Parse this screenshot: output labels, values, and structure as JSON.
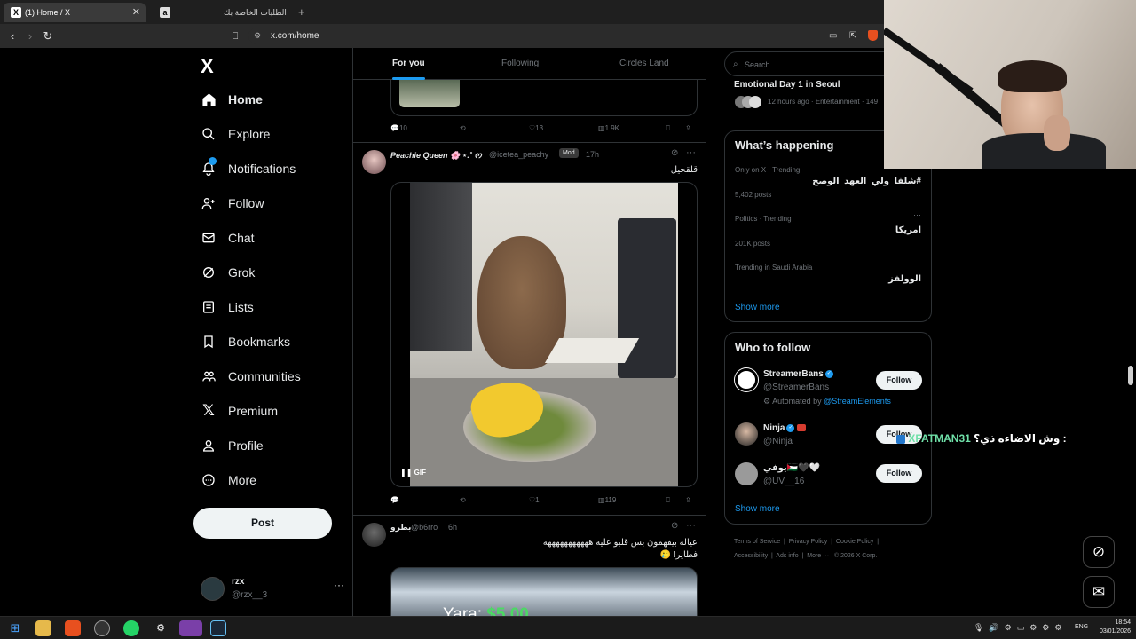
{
  "browser": {
    "tabs": [
      {
        "label": "(1) Home / X",
        "active": true
      },
      {
        "label": "الطلبات الخاصة بك",
        "active": false
      }
    ],
    "new_tab": "+",
    "url": "x.com/home"
  },
  "sidebar": {
    "logo": "X",
    "items": [
      {
        "label": "Home",
        "icon": "home-icon"
      },
      {
        "label": "Explore",
        "icon": "search-icon"
      },
      {
        "label": "Notifications",
        "icon": "bell-icon"
      },
      {
        "label": "Follow",
        "icon": "add-person-icon"
      },
      {
        "label": "Chat",
        "icon": "mail-icon"
      },
      {
        "label": "Grok",
        "icon": "grok-icon"
      },
      {
        "label": "Lists",
        "icon": "list-icon"
      },
      {
        "label": "Bookmarks",
        "icon": "bookmark-icon"
      },
      {
        "label": "Communities",
        "icon": "communities-icon"
      },
      {
        "label": "Premium",
        "icon": "x-premium-icon"
      },
      {
        "label": "Profile",
        "icon": "person-icon"
      },
      {
        "label": "More",
        "icon": "more-circle-icon"
      }
    ],
    "post_label": "Post",
    "account": {
      "name": "rzx",
      "handle": "@rzx__3",
      "more": "···"
    }
  },
  "feed": {
    "tabs": [
      "For you",
      "Following",
      "Circles Land"
    ],
    "prev_actions": {
      "replies": "10",
      "likes": "13",
      "views": "1.9K"
    },
    "tweets": [
      {
        "name": "Peachie Queen 🌸 ⋆.˚ ᰔ",
        "handle": "@icetea_peachy",
        "badge": "Mod",
        "time": "17h",
        "text": "قلقحيل",
        "gif_label": "GIF",
        "actions": {
          "likes": "1",
          "views": "119"
        }
      },
      {
        "name": "بطرو",
        "handle": "@b6rro",
        "time": "6h",
        "text_line1": "عياله بيفهمون بس قلبو عليه هههههههههههه",
        "text_line2": "فطاير! 🥲",
        "overlay_text": "Yara: ",
        "overlay_amount": "$5.00"
      }
    ]
  },
  "right": {
    "search_placeholder": "Search",
    "top_trend": {
      "title": "Emotional Day 1 in Seoul",
      "meta": "12 hours ago · Entertainment · 149"
    },
    "happening": {
      "title": "What’s happening",
      "trends": [
        {
          "context": "Only on X · Trending",
          "title": "#شلفا_ولي_العهد_الوصح",
          "count": "5,402 posts"
        },
        {
          "context": "Politics · Trending",
          "title": "امريكا",
          "count": "201K posts"
        },
        {
          "context": "Trending in Saudi Arabia",
          "title": "الوولفز",
          "count": ""
        }
      ],
      "show_more": "Show more"
    },
    "who_to_follow": {
      "title": "Who to follow",
      "accounts": [
        {
          "name": "StreamerBans",
          "handle": "@StreamerBans",
          "note": "Automated by",
          "note_link": "@StreamElements",
          "button": "Follow"
        },
        {
          "name": "Ninja",
          "handle": "@Ninja",
          "button": "Follow"
        },
        {
          "name": "يوفي🇵🇸🖤🤍",
          "handle": "@UV__16",
          "button": "Follow"
        }
      ],
      "show_more": "Show more"
    },
    "footer": [
      "Terms of Service",
      "Privacy Policy",
      "Cookie Policy",
      "Accessibility",
      "Ads info",
      "More ···",
      "© 2026 X Corp."
    ]
  },
  "chat_overlay": {
    "user": "XFATMAN31",
    "message": "وش الاضاءه ذي؟ :"
  },
  "taskbar": {
    "lang": "ENG",
    "time": "18:54",
    "date": "03/01/2026"
  }
}
